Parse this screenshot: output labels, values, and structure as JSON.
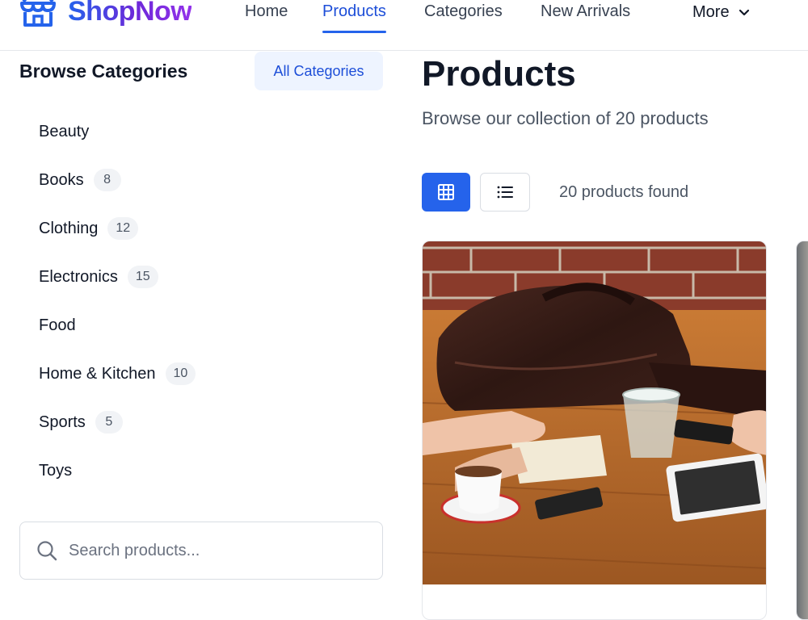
{
  "brand": {
    "name": "ShopNow",
    "icon": "storefront-icon",
    "gradient": [
      "#2563eb",
      "#9333ea"
    ]
  },
  "nav": {
    "links": [
      {
        "label": "Home",
        "active": false
      },
      {
        "label": "Products",
        "active": true
      },
      {
        "label": "Categories",
        "active": false
      },
      {
        "label": "New Arrivals",
        "active": false
      }
    ],
    "more": {
      "label": "More",
      "icon": "chevron-down-icon"
    }
  },
  "sidebar": {
    "title": "Browse Categories",
    "all_categories_label": "All Categories",
    "categories": [
      {
        "name": "Beauty",
        "count": ""
      },
      {
        "name": "Books",
        "count": "8"
      },
      {
        "name": "Clothing",
        "count": "12"
      },
      {
        "name": "Electronics",
        "count": "15"
      },
      {
        "name": "Food",
        "count": ""
      },
      {
        "name": "Home & Kitchen",
        "count": "10"
      },
      {
        "name": "Sports",
        "count": "5"
      },
      {
        "name": "Toys",
        "count": ""
      }
    ],
    "search": {
      "placeholder": "Search products...",
      "value": "",
      "icon": "search-icon"
    }
  },
  "main": {
    "title": "Products",
    "subtitle": "Browse our collection of 20 products",
    "view": {
      "active": "grid",
      "grid_icon": "grid-view-icon",
      "list_icon": "list-view-icon"
    },
    "results_text": "20 products found",
    "products": [
      {
        "image": "photo of leather bag, glass of water, coffee cup and tablet on wooden table"
      }
    ]
  },
  "colors": {
    "accent": "#2563eb",
    "active_nav": "#1d4ed8",
    "badge_bg": "#f1f3f6",
    "all_categories_bg": "#eef4ff"
  }
}
